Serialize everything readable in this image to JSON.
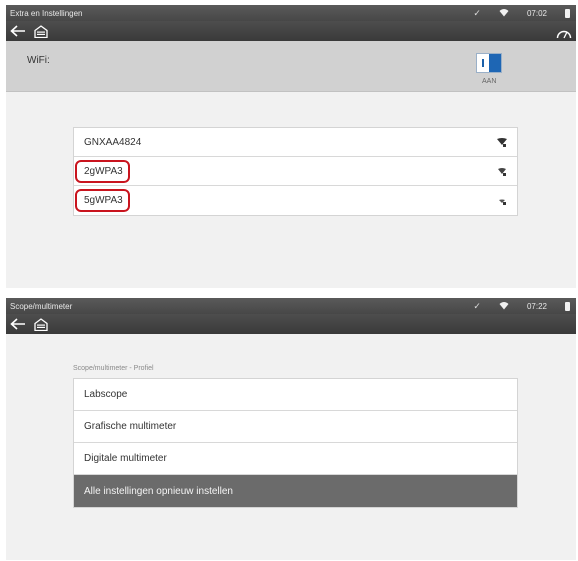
{
  "wifi_screen": {
    "status": {
      "title": "Extra en Instellingen",
      "time": "07:02"
    },
    "wifi_label": "WiFi:",
    "toggle_state": "AAN",
    "networks": [
      {
        "name": "GNXAA4824",
        "circled": false
      },
      {
        "name": "2gWPA3",
        "circled": true
      },
      {
        "name": "5gWPA3",
        "circled": true
      }
    ]
  },
  "scope_screen": {
    "status": {
      "title": "Scope/multimeter",
      "time": "07:22"
    },
    "section_label": "Scope/multimeter - Profiel",
    "items": [
      {
        "label": "Labscope"
      },
      {
        "label": "Grafische multimeter"
      },
      {
        "label": "Digitale multimeter"
      },
      {
        "label": "Alle instellingen opnieuw instellen"
      }
    ]
  },
  "colors": {
    "highlight_circle": "#c9141e",
    "toggle_on": "#1e66b4",
    "active_row": "#6b6b6b"
  },
  "icons": [
    "back-arrow-icon",
    "home-icon",
    "gauge-icon",
    "wifi-status-icon",
    "battery-icon",
    "signal-icon"
  ]
}
